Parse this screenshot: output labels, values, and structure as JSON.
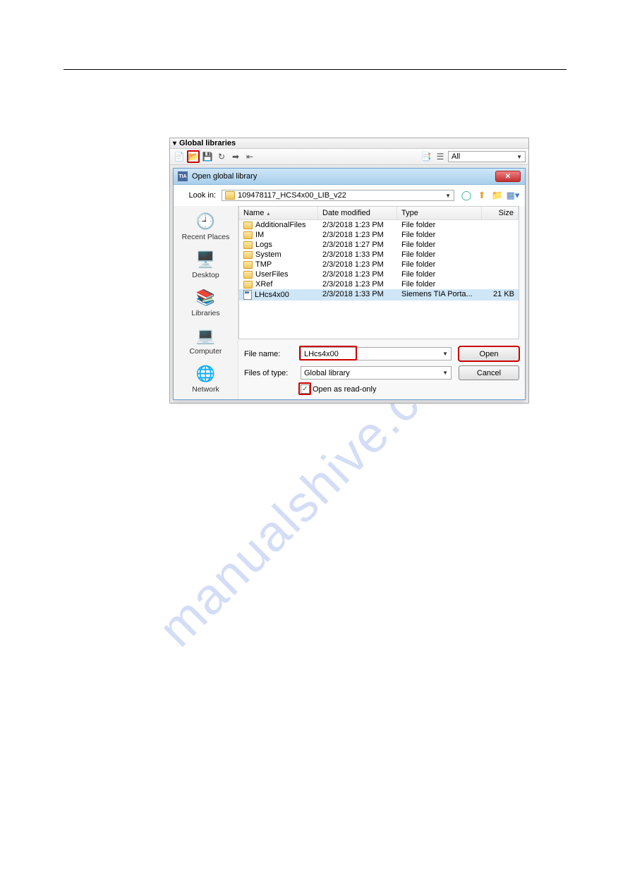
{
  "watermark": "manualshive.com",
  "panel": {
    "title": "Global libraries"
  },
  "toolbar": {
    "filter_label": "All"
  },
  "dialog": {
    "title": "Open global library",
    "lookin_label": "Look in:",
    "lookin_value": "109478117_HCS4x00_LIB_v22",
    "columns": {
      "name": "Name",
      "date": "Date modified",
      "type": "Type",
      "size": "Size"
    },
    "rows": [
      {
        "name": "AdditionalFiles",
        "date": "2/3/2018 1:23 PM",
        "type": "File folder",
        "size": "",
        "kind": "folder"
      },
      {
        "name": "IM",
        "date": "2/3/2018 1:23 PM",
        "type": "File folder",
        "size": "",
        "kind": "folder"
      },
      {
        "name": "Logs",
        "date": "2/3/2018 1:27 PM",
        "type": "File folder",
        "size": "",
        "kind": "folder"
      },
      {
        "name": "System",
        "date": "2/3/2018 1:33 PM",
        "type": "File folder",
        "size": "",
        "kind": "folder"
      },
      {
        "name": "TMP",
        "date": "2/3/2018 1:23 PM",
        "type": "File folder",
        "size": "",
        "kind": "folder"
      },
      {
        "name": "UserFiles",
        "date": "2/3/2018 1:23 PM",
        "type": "File folder",
        "size": "",
        "kind": "folder"
      },
      {
        "name": "XRef",
        "date": "2/3/2018 1:23 PM",
        "type": "File folder",
        "size": "",
        "kind": "folder"
      },
      {
        "name": "LHcs4x00",
        "date": "2/3/2018 1:33 PM",
        "type": "Siemens TIA Porta...",
        "size": "21 KB",
        "kind": "file",
        "selected": true
      }
    ],
    "places": [
      {
        "label": "Recent Places"
      },
      {
        "label": "Desktop"
      },
      {
        "label": "Libraries"
      },
      {
        "label": "Computer"
      },
      {
        "label": "Network"
      }
    ],
    "file_name_label": "File name:",
    "file_name_value": "LHcs4x00",
    "files_of_type_label": "Files of type:",
    "files_of_type_value": "Global library",
    "open_label": "Open",
    "cancel_label": "Cancel",
    "readonly_label": "Open as read-only"
  }
}
